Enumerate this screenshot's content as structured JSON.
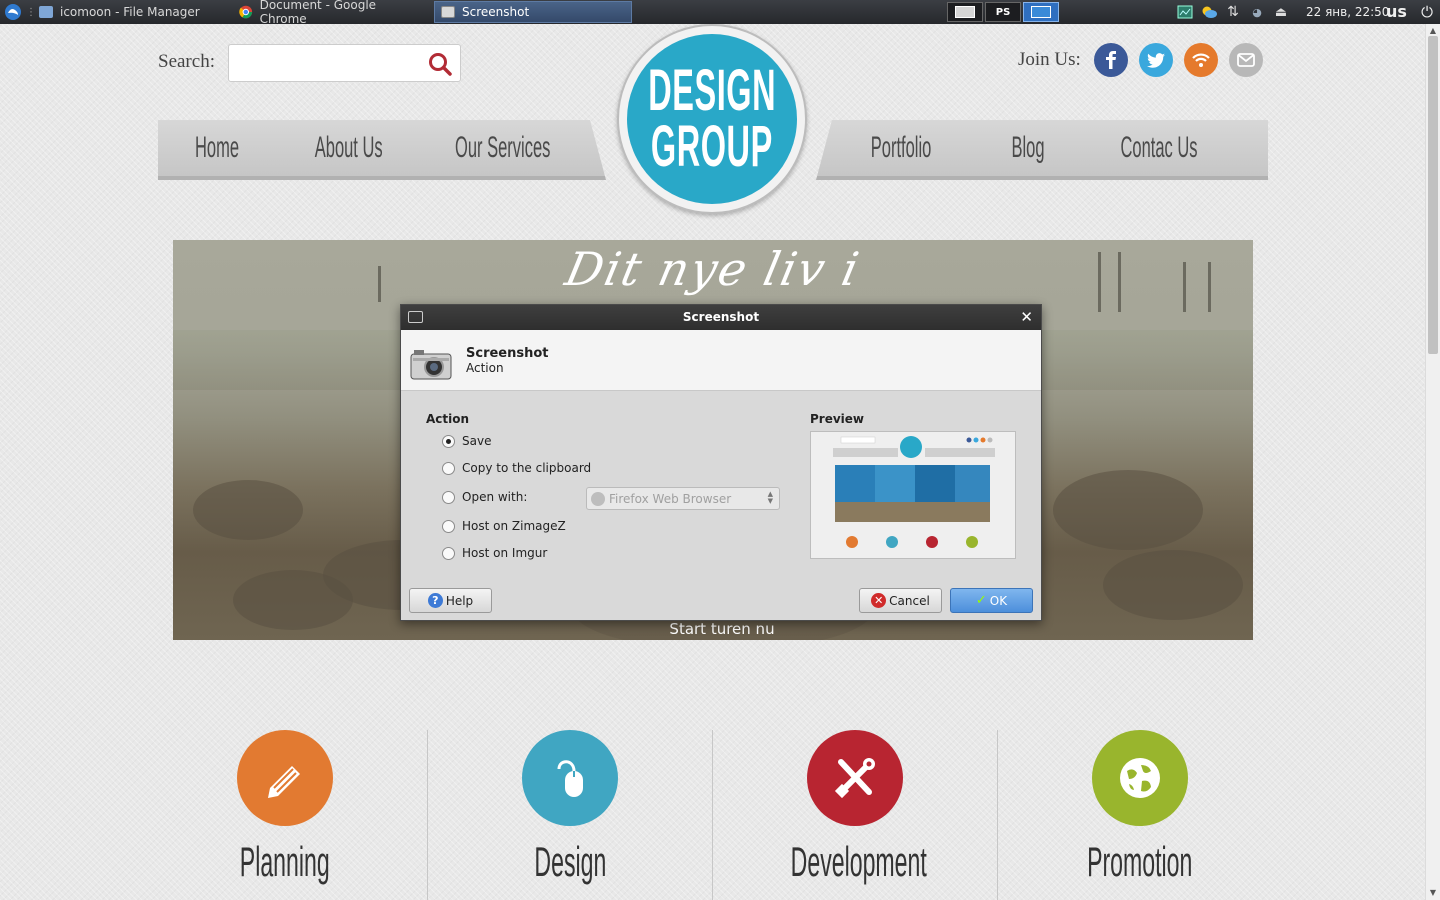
{
  "taskbar": {
    "tasks": [
      {
        "label": "icomoon - File Manager"
      },
      {
        "label": "Document - Google Chrome"
      },
      {
        "label": "Screenshot"
      }
    ],
    "pager": {
      "ps_label": "PS"
    },
    "clock": "22 янв, 22:50",
    "keyboard": "us"
  },
  "header": {
    "search_label": "Search:",
    "search_value": "",
    "join_label": "Join Us:"
  },
  "social": [
    {
      "name": "facebook",
      "color": "#3b5998"
    },
    {
      "name": "twitter",
      "color": "#3aa8dd"
    },
    {
      "name": "rss",
      "color": "#e57a2c"
    },
    {
      "name": "email",
      "color": "#b8b8b8"
    }
  ],
  "nav": {
    "left": [
      "Home",
      "About Us",
      "Our Services"
    ],
    "right": [
      "Portfolio",
      "Blog",
      "Contac Us"
    ]
  },
  "logo": {
    "line1": "DESIGN",
    "line2": "GROUP",
    "color": "#29a8c8"
  },
  "hero": {
    "title": "Dit nye liv i",
    "cta": "Start turen nu"
  },
  "dialog": {
    "title": "Screenshot",
    "header_title": "Screenshot",
    "header_subtitle": "Action",
    "action_label": "Action",
    "preview_label": "Preview",
    "options": [
      "Save",
      "Copy to the clipboard",
      "Open with:",
      "Host on ZimageZ",
      "Host on Imgur"
    ],
    "selected_option": "Save",
    "open_with_value": "Firefox Web Browser",
    "help_label": "Help",
    "cancel_label": "Cancel",
    "ok_label": "OK"
  },
  "features": [
    {
      "label": "Planning",
      "color": "#e27a31",
      "icon": "pencil-icon"
    },
    {
      "label": "Design",
      "color": "#40a6c2",
      "icon": "mouse-icon"
    },
    {
      "label": "Development",
      "color": "#b82531",
      "icon": "tools-icon"
    },
    {
      "label": "Promotion",
      "color": "#99b52d",
      "icon": "globe-icon"
    }
  ]
}
